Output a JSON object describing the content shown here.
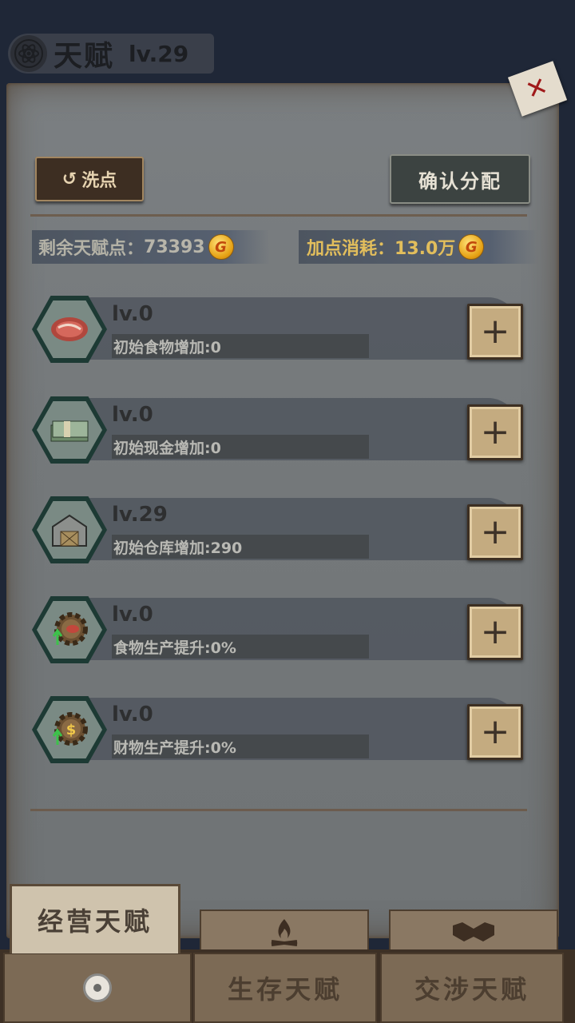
{
  "header": {
    "title": "天赋",
    "level": "lv.29",
    "icon": "atom-icon"
  },
  "actions": {
    "reset_label": "洗点",
    "confirm_label": "确认分配"
  },
  "points": {
    "remaining_label": "剩余天赋点：",
    "remaining_value": "73393",
    "cost_label": "加点消耗：",
    "cost_value": "13.0万",
    "coin_symbol": "G"
  },
  "talents": [
    {
      "icon": "meat-icon",
      "level": "lv.0",
      "desc": "初始食物增加:0"
    },
    {
      "icon": "cash-stack-icon",
      "level": "lv.0",
      "desc": "初始现金增加:0"
    },
    {
      "icon": "warehouse-icon",
      "level": "lv.29",
      "desc": "初始仓库增加:290"
    },
    {
      "icon": "food-production-gear-icon",
      "level": "lv.0",
      "desc": "食物生产提升:0%"
    },
    {
      "icon": "money-production-gear-icon",
      "level": "lv.0",
      "desc": "财物生产提升:0%"
    }
  ],
  "tabs": {
    "active": "经营天赋",
    "survival": "生存天赋",
    "negotiation": "交涉天赋",
    "survival_icon": "campfire-icon",
    "negotiation_icon": "handshake-icon"
  },
  "colors": {
    "panel": "#75797b",
    "accent_gold": "#e2be5c",
    "button_dark": "#3d2e22"
  }
}
